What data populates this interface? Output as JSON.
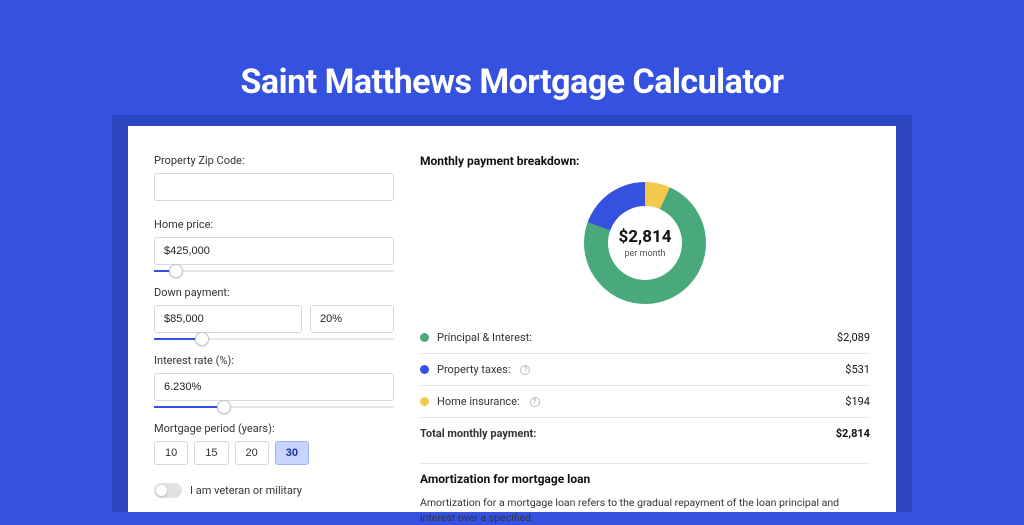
{
  "header": {
    "title": "Saint Matthews Mortgage Calculator"
  },
  "form": {
    "zip": {
      "label": "Property Zip Code:",
      "value": ""
    },
    "homePrice": {
      "label": "Home price:",
      "value": "$425,000",
      "sliderPercent": 9
    },
    "downPayment": {
      "label": "Down payment:",
      "value": "$85,000",
      "percent": "20%",
      "sliderPercent": 20
    },
    "interestRate": {
      "label": "Interest rate (%):",
      "value": "6.230%",
      "sliderPercent": 29
    },
    "mortgagePeriod": {
      "label": "Mortgage period (years):",
      "options": [
        "10",
        "15",
        "20",
        "30"
      ],
      "selected": "30"
    },
    "veteran": {
      "label": "I am veteran or military",
      "checked": false
    }
  },
  "breakdown": {
    "title": "Monthly payment breakdown:",
    "donut": {
      "amount": "$2,814",
      "period": "per month"
    },
    "items": [
      {
        "label": "Principal & Interest:",
        "value": "$2,089",
        "color": "#4aa97a",
        "info": false
      },
      {
        "label": "Property taxes:",
        "value": "$531",
        "color": "#3451e0",
        "info": true
      },
      {
        "label": "Home insurance:",
        "value": "$194",
        "color": "#f2c94c",
        "info": true
      }
    ],
    "total": {
      "label": "Total monthly payment:",
      "value": "$2,814"
    }
  },
  "amortization": {
    "title": "Amortization for mortgage loan",
    "text": "Amortization for a mortgage loan refers to the gradual repayment of the loan principal and interest over a specified"
  },
  "chart_data": {
    "type": "pie",
    "title": "Monthly payment breakdown",
    "series": [
      {
        "name": "Principal & Interest",
        "value": 2089,
        "color": "#4aa97a"
      },
      {
        "name": "Property taxes",
        "value": 531,
        "color": "#3451e0"
      },
      {
        "name": "Home insurance",
        "value": 194,
        "color": "#f2c94c"
      }
    ],
    "total": 2814,
    "center_label": "$2,814 per month"
  }
}
